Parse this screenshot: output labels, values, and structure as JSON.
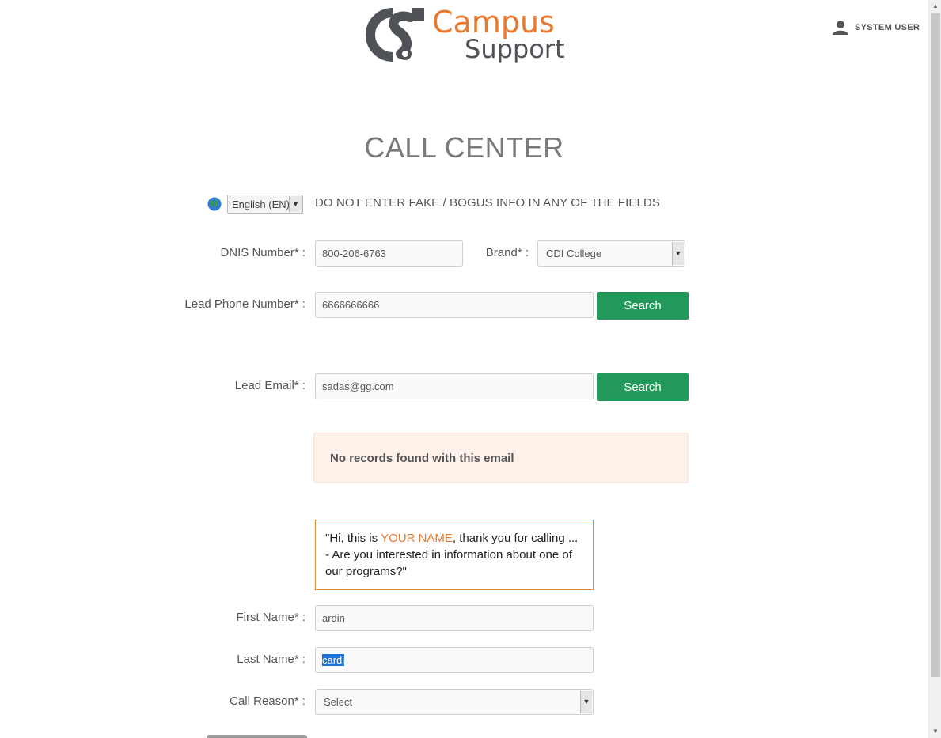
{
  "header": {
    "logo_word1": "Campus",
    "logo_word2": "Support",
    "user_label": "SYSTEM USER"
  },
  "page_title": "CALL CENTER",
  "language": {
    "selected": "English (EN)",
    "warning": "DO NOT ENTER FAKE / BOGUS INFO IN ANY OF THE FIELDS"
  },
  "form": {
    "dnis": {
      "label": "DNIS Number* :",
      "value": "800-206-6763"
    },
    "brand": {
      "label": "Brand* :",
      "value": "CDI College"
    },
    "lead_phone": {
      "label": "Lead Phone Number* :",
      "value": "6666666666",
      "search_label": "Search"
    },
    "lead_email": {
      "label": "Lead Email* :",
      "value": "sadas@gg.com",
      "search_label": "Search"
    },
    "alert": "No records found with this email",
    "script": {
      "part1": "\"Hi, this is ",
      "highlight": "YOUR NAME",
      "part2": ", thank you for calling ... - Are you interested in information about one of our programs?\""
    },
    "first_name": {
      "label": "First Name* :",
      "value": "ardin"
    },
    "last_name": {
      "label": "Last Name* :",
      "value": "cardi"
    },
    "call_reason": {
      "label": "Call Reason* :",
      "value": "Select"
    }
  },
  "colors": {
    "brand_orange": "#e8792e",
    "brand_gray": "#4f5257",
    "button_green": "#22995a",
    "alert_bg": "#fdf1ea"
  }
}
